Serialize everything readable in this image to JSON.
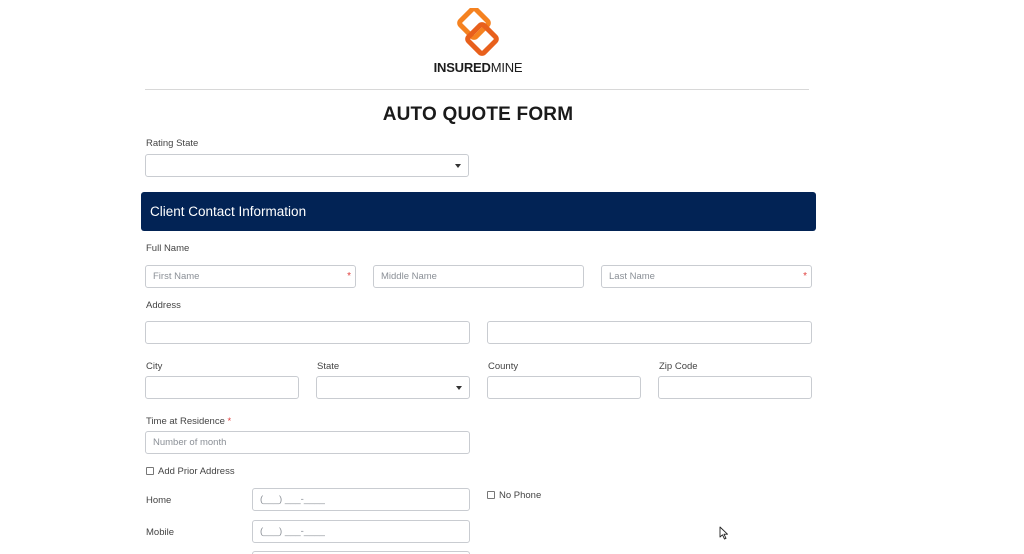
{
  "brand": {
    "logo_bold": "INSURED",
    "logo_light": "MINE",
    "colors": {
      "orange": "#f58220",
      "dark_orange": "#e8601c",
      "navy": "#022355"
    }
  },
  "form": {
    "title": "AUTO QUOTE FORM"
  },
  "rating_state": {
    "label": "Rating State",
    "value": ""
  },
  "section": {
    "title": "Client Contact Information"
  },
  "full_name": {
    "label": "Full Name",
    "first_placeholder": "First Name",
    "middle_placeholder": "Middle Name",
    "last_placeholder": "Last Name",
    "required_mark": "*"
  },
  "address": {
    "label": "Address"
  },
  "city": {
    "label": "City"
  },
  "state": {
    "label": "State"
  },
  "county": {
    "label": "County"
  },
  "zip": {
    "label": "Zip Code"
  },
  "residence": {
    "label": "Time at Residence",
    "required_mark": "*",
    "placeholder": "Number of month"
  },
  "prior_address": {
    "label": "Add Prior Address",
    "checked": false
  },
  "phones": {
    "home_label": "Home",
    "home_placeholder": "(___) ___-____",
    "mobile_label": "Mobile",
    "mobile_placeholder": "(___) ___-____",
    "no_phone_label": "No Phone",
    "no_phone_checked": false
  },
  "icons": {
    "caret": "chevron-down-icon",
    "cursor": "mouse-cursor-icon"
  }
}
